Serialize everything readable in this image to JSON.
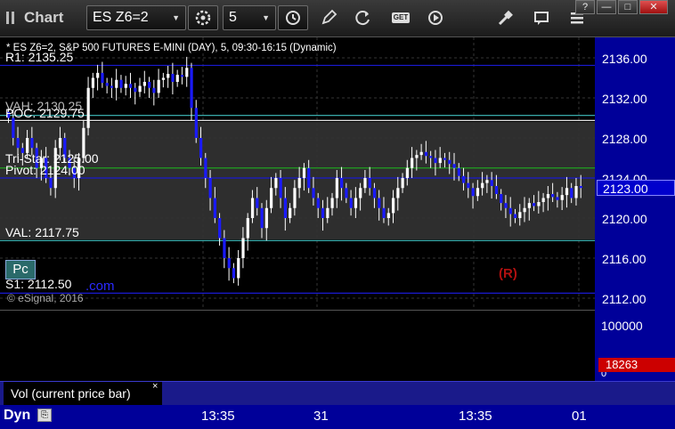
{
  "toolbar": {
    "app_title": "Chart",
    "symbol": "ES Z6=2",
    "interval": "5",
    "icons": [
      "grip-icon",
      "gear-icon",
      "clock-icon",
      "pencil-icon",
      "refresh-icon",
      "get-icon",
      "play-icon",
      "tools-icon",
      "chat-icon",
      "menu-icon"
    ],
    "window_controls": [
      "?",
      "—",
      "□",
      "✕"
    ]
  },
  "chart": {
    "header": "* ES Z6=2, S&P 500 FUTURES E-MINI (DAY), 5, 09:30-16:15 (Dynamic)",
    "copyright": "© eSignal, 2016",
    "current_price": "2123.00",
    "price_ticks": [
      "2136.00",
      "2132.00",
      "2128.00",
      "2124.00",
      "2120.00",
      "2116.00",
      "2112.00"
    ],
    "levels": [
      {
        "label": "R1: 2135.25",
        "price": 2135.25,
        "color": "#1a1ad0"
      },
      {
        "label": "VAH: 2130.25",
        "price": 2130.25,
        "color": "#40c0c0"
      },
      {
        "label": "POC: 2129.75",
        "price": 2129.75,
        "color": "#ffffff"
      },
      {
        "label": "Tri-Star: 2125.00",
        "price": 2125.0,
        "color": "#20a020"
      },
      {
        "label": "Pivot: 2124.00",
        "price": 2124.0,
        "color": "#1a1ad0"
      },
      {
        "label": "VAL: 2117.75",
        "price": 2117.75,
        "color": "#40c0c0"
      },
      {
        "label": "S1: 2112.50",
        "price": 2112.5,
        "color": "#1a1ad0"
      }
    ],
    "label_tags": {
      "vah": "VAH: 2130.25",
      "poc": "POC: 2129.75",
      "tristar": "Tri-Star: 2125.00",
      "pivot": "Pivot: 2124.00"
    },
    "pc_button": "Pc",
    "com_text": ".com",
    "r_marker": "(R)",
    "colors": {
      "bull": "#ffffff",
      "bear": "#1a1aff",
      "axis_bg": "#000099",
      "price_tag": "#0000cc",
      "vol_tag": "#cc0000"
    }
  },
  "volume": {
    "tab_label": "Vol (current price bar)",
    "close": "×",
    "ticks": [
      "100000",
      "0"
    ],
    "current_value": "18263"
  },
  "time_axis": {
    "label": "Dyn",
    "ticks": [
      "13:35",
      "31",
      "13:35",
      "01"
    ]
  }
}
